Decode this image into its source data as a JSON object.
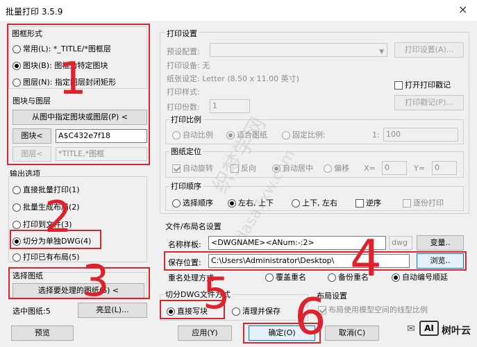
{
  "window": {
    "title": "批量打印 3.5.9",
    "close_glyph": "×"
  },
  "frame_style": {
    "title": "图框形式",
    "options": [
      {
        "label": "常用(L): *_TITLE/*图框层",
        "selected": false
      },
      {
        "label": "图块(B): 图框为特定图块",
        "selected": true
      },
      {
        "label": "图层(N): 指定图层封闭矩形",
        "selected": false
      }
    ]
  },
  "block_layer": {
    "title": "图块与图层",
    "pick_button": "从图中指定图块或图层(P) <",
    "block_button": "图块<",
    "block_value": "A$C432e7f18",
    "layer_button": "图层<",
    "layer_value": "*TITLE,*图框"
  },
  "output": {
    "title": "输出选项",
    "options": [
      {
        "label": "直接批量打印(1)",
        "selected": false
      },
      {
        "label": "批量生成布局(2)",
        "selected": false
      },
      {
        "label": "打印到文件(3)",
        "selected": false
      },
      {
        "label": "切分为单独DWG(4)",
        "selected": true
      },
      {
        "label": "打印已有布局(5)",
        "selected": false
      }
    ]
  },
  "select_drawings": {
    "title": "选择图纸",
    "select_button": "选择要处理的图纸(S) <",
    "count_label": "选中图纸:5",
    "highlight_button": "亮显(L)..."
  },
  "print_settings": {
    "title": "打印设置",
    "preset_label": "预设配置:",
    "settings_button": "打印设置(A)...",
    "device_label": "打印设备: 无",
    "paper_label": "纸张设定: Letter (8.50 x 11.00 英寸)",
    "style_label": "打印样式:",
    "stamp_check": "打开打印戳记",
    "stamp_button": "打印戳记(P)...",
    "copies_label": "打印份数:",
    "copies_value": "1"
  },
  "scale": {
    "title": "打印比例",
    "auto": "自动比例",
    "fit": "适合图纸",
    "fixed": "固定比例:",
    "ratio_prefix": "1:",
    "ratio_value": "100"
  },
  "position": {
    "title": "图纸定位",
    "auto_rotate": "自动旋转",
    "reverse": "反向",
    "center": "自动居中",
    "offset": "偏移",
    "x_label": "X=",
    "x_value": "0",
    "y_label": "Y=",
    "y_value": "0"
  },
  "order": {
    "title": "打印顺序",
    "options": [
      {
        "label": "选择顺序",
        "selected": false
      },
      {
        "label": "左右, 上下",
        "selected": true
      },
      {
        "label": "上下, 左右",
        "selected": false
      }
    ],
    "reverse": "逆序",
    "reverse_print": "逐份打印"
  },
  "file_naming": {
    "title": "文件/布局名设置",
    "name_label": "名称样板:",
    "name_value": "<DWGNAME><ANum:-:2>",
    "ext": "dwg",
    "var_button": "变量..",
    "save_label": "保存位置:",
    "save_value": "C:\\Users\\Administrator\\Desktop\\",
    "browse_button": "浏览..",
    "dup_label": "重名处理方式:",
    "dup_options": [
      {
        "label": "覆盖重名",
        "selected": false
      },
      {
        "label": "备份重名",
        "selected": false
      },
      {
        "label": "自动编号顺延",
        "selected": true
      }
    ]
  },
  "split": {
    "title": "切分DWG文件方式",
    "options": [
      {
        "label": "直接写块",
        "selected": true
      },
      {
        "label": "清理并保存",
        "selected": false
      }
    ]
  },
  "layout": {
    "title": "布局设置",
    "check": "布局使用模型空间的线型比例"
  },
  "footer": {
    "preview": "预览",
    "apply": "应用(Y)",
    "ok": "确定(O)",
    "cancel": "取消(C)"
  },
  "annotations": [
    "1",
    "2",
    "3",
    "4",
    "5",
    "6"
  ],
  "watermark": {
    "center": "织梦学网",
    "side": "dasa7xw.com",
    "brand": "树叶云"
  }
}
